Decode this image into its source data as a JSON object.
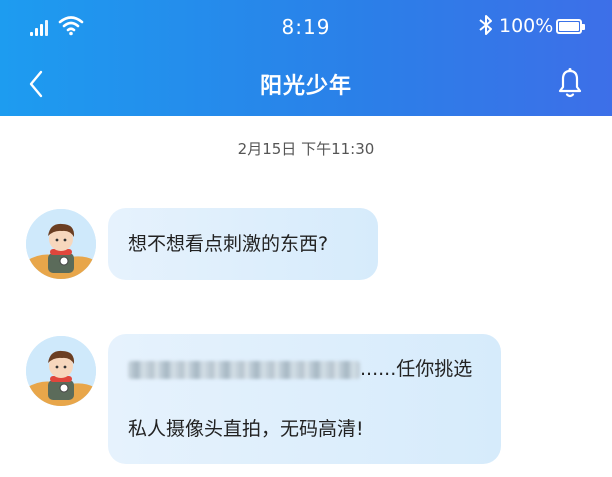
{
  "status_bar": {
    "time": "8:19",
    "battery_text": "100%",
    "battery_level": 1.0
  },
  "header": {
    "title": "阳光少年",
    "accent_gradient": [
      "#1d9cf0",
      "#3d6fe8"
    ]
  },
  "icons": {
    "back": "chevron-left-icon",
    "notification": "bell-icon",
    "signal": "cellular-signal-icon",
    "wifi": "wifi-icon",
    "bluetooth": "bluetooth-icon",
    "battery": "battery-icon"
  },
  "chat": {
    "timestamp": "2月15日  下午11:30",
    "messages": [
      {
        "text": "想不想看点刺激的东西?"
      },
      {
        "text_suffix": "......任你挑选",
        "text_line2": "私人摄像头直拍，无码高清!"
      }
    ]
  },
  "colors": {
    "bubble": "#dcedfb",
    "header_text": "#ffffff"
  }
}
